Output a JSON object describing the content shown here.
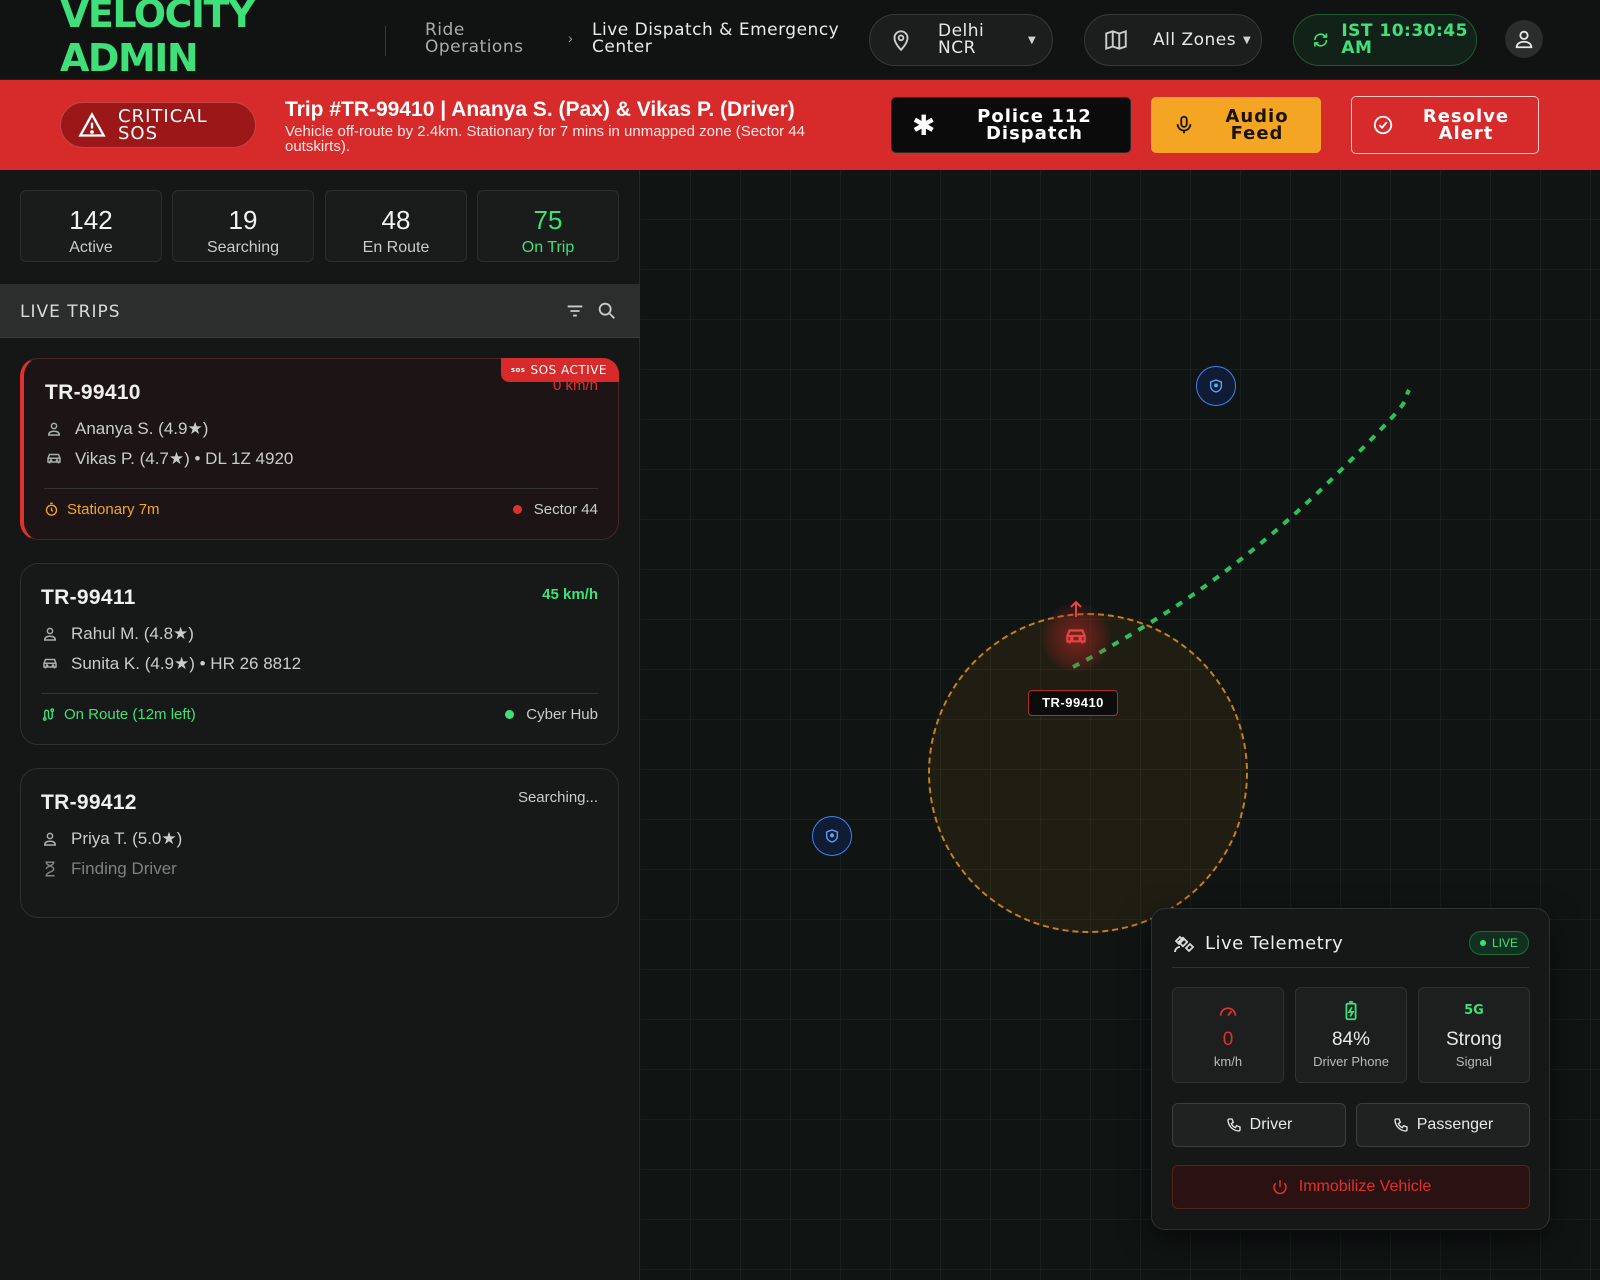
{
  "header": {
    "brand": "VELOCITY\nADMIN",
    "breadcrumb": [
      "Ride Operations",
      "Live Dispatch & Emergency Center"
    ],
    "region": "Delhi NCR",
    "zones": "All Zones",
    "clock": "IST 10:30:45 AM"
  },
  "sos_banner": {
    "level": "CRITICAL SOS",
    "title": "Trip #TR-99410 | Ananya S. (Pax) & Vikas P. (Driver)",
    "description": "Vehicle off-route by 2.4km. Stationary for 7 mins in unmapped zone (Sector 44 outskirts).",
    "police_button": "Police 112 Dispatch",
    "audio_button": "Audio Feed",
    "resolve_button": "Resolve Alert"
  },
  "stats": [
    {
      "value": "142",
      "label": "Active"
    },
    {
      "value": "19",
      "label": "Searching"
    },
    {
      "value": "48",
      "label": "En Route"
    },
    {
      "value": "75",
      "label": "On Trip"
    }
  ],
  "trips_panel": {
    "title": "LIVE TRIPS",
    "trips": [
      {
        "id": "TR-99410",
        "badge": "SOS ACTIVE",
        "badge_icon": "sos",
        "speed": "0 km/h",
        "passenger": "Ananya S. (4.9★)",
        "driver": "Vikas P. (4.7★) • DL 1Z 4920",
        "status": "Stationary 7m",
        "location": "Sector 44"
      },
      {
        "id": "TR-99411",
        "speed": "45 km/h",
        "passenger": "Rahul M. (4.8★)",
        "driver": "Sunita K. (4.9★) • HR 26 8812",
        "status": "On Route (12m left)",
        "location": "Cyber Hub"
      },
      {
        "id": "TR-99412",
        "speed": "Searching...",
        "passenger": "Priya T. (5.0★)",
        "driver": "Finding Driver"
      }
    ]
  },
  "map": {
    "vehicle_label": "TR-99410"
  },
  "telemetry": {
    "title": "Live Telemetry",
    "live": "LIVE",
    "speed_value": "0",
    "speed_unit": "km/h",
    "battery_value": "84%",
    "battery_label": "Driver Phone",
    "signal_icon_text": "5G",
    "signal_value": "Strong",
    "signal_label": "Signal",
    "call_driver": "Driver",
    "call_passenger": "Passenger",
    "immobilize": "Immobilize Vehicle"
  },
  "colors": {
    "accent_green": "#3ee07a",
    "sos_red": "#d72a2a",
    "warning_amber": "#f5a524",
    "police_blue": "#3b82f6"
  }
}
